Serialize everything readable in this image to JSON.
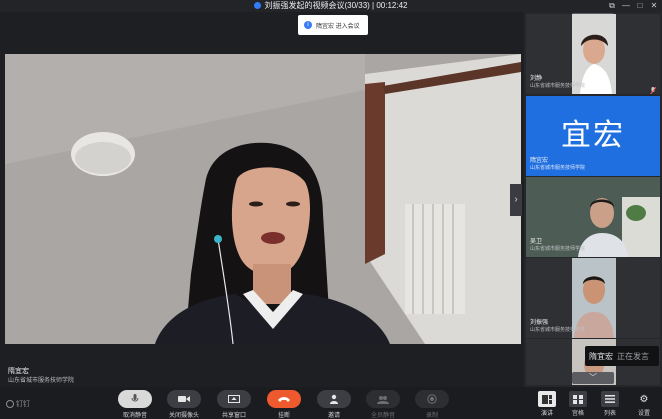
{
  "window": {
    "title": "刘振强发起的视频会议(30/33) | 00:12:42",
    "controls": [
      "restore-icon",
      "minimize-icon",
      "maximize-icon",
      "close-icon"
    ]
  },
  "toast": {
    "text": "隋宜宏 进入会议"
  },
  "main": {
    "speaker_name": "隋宜宏",
    "speaker_org": "山东省城市服务技师学院"
  },
  "sidebar": {
    "tiles": [
      {
        "name": "刘静",
        "org": "山东省城市服务技师学院"
      },
      {
        "name": "隋宜宏",
        "org": "山东省城市服务技师学院",
        "avatar_text": "宜宏",
        "avatar_color": "#1f6fe0"
      },
      {
        "name": "吴卫",
        "org": "山东省城市服务技师学院"
      },
      {
        "name": "刘振强",
        "org": "山东省城市服务技师学院"
      }
    ],
    "speaking_name": "隋宜宏",
    "speaking_status": "正在发言"
  },
  "toolbar": {
    "logo": "钉钉",
    "buttons": [
      {
        "label": "取消静音",
        "icon": "microphone-icon"
      },
      {
        "label": "关闭摄像头",
        "icon": "camera-icon"
      },
      {
        "label": "共享窗口",
        "icon": "screen-share-icon"
      },
      {
        "label": "挂断",
        "icon": "hang-up-icon"
      },
      {
        "label": "邀请",
        "icon": "add-person-icon"
      },
      {
        "label": "全员静音",
        "icon": "mute-all-icon"
      },
      {
        "label": "录制",
        "icon": "record-icon"
      }
    ],
    "right_buttons": [
      {
        "label": "演讲",
        "icon": "speaker-view-icon"
      },
      {
        "label": "宫格",
        "icon": "grid-view-icon"
      },
      {
        "label": "列表",
        "icon": "list-icon"
      },
      {
        "label": "设置",
        "icon": "gear-icon"
      }
    ]
  },
  "colors": {
    "accent": "#1f6fe0",
    "hangup": "#ee5a2e"
  }
}
